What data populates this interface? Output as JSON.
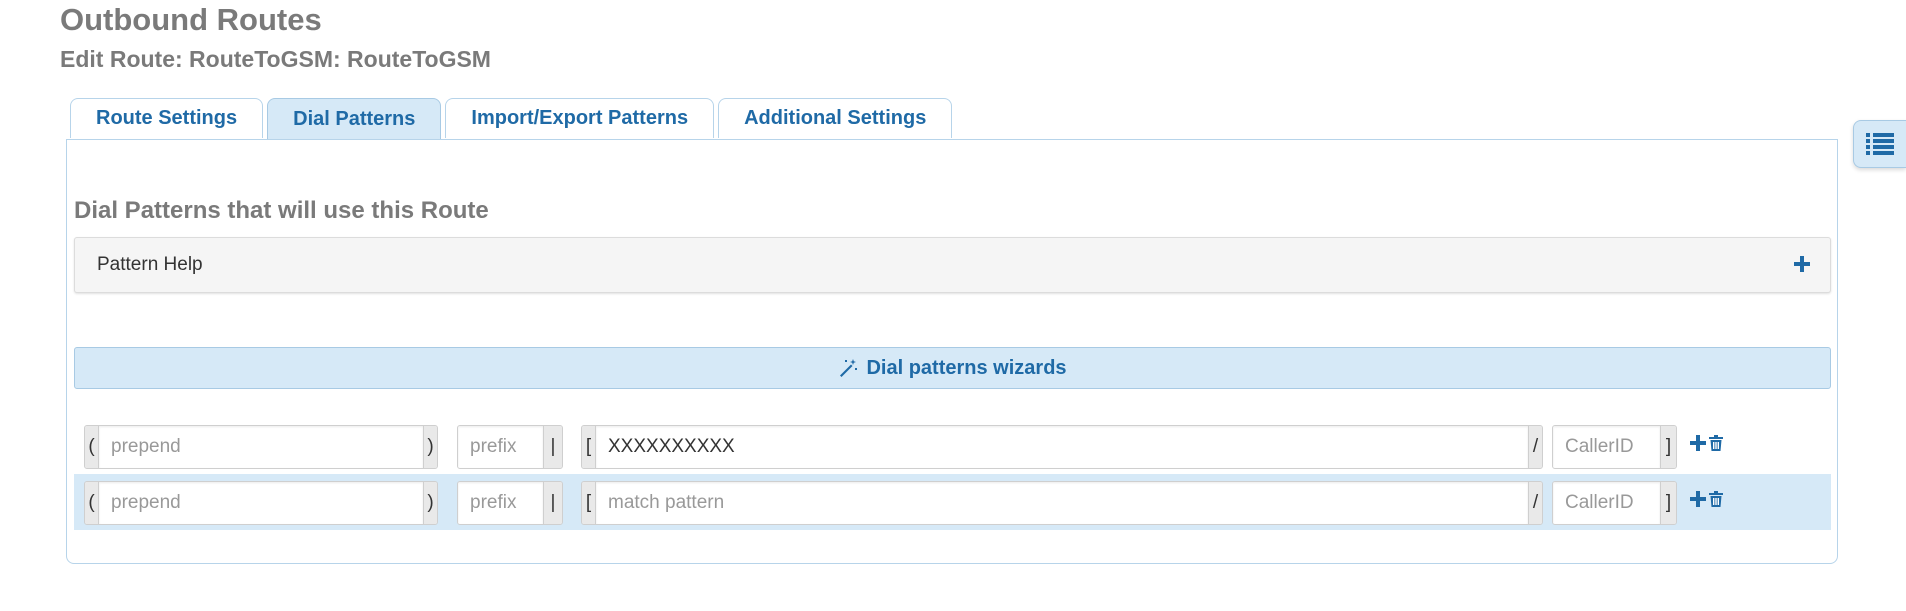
{
  "header": {
    "title": "Outbound Routes",
    "subtitle": "Edit Route: RouteToGSM: RouteToGSM"
  },
  "tabs": [
    {
      "label": "Route Settings",
      "active": false
    },
    {
      "label": "Dial Patterns",
      "active": true
    },
    {
      "label": "Import/Export Patterns",
      "active": false
    },
    {
      "label": "Additional Settings",
      "active": false
    }
  ],
  "section": {
    "heading": "Dial Patterns that will use this Route",
    "help_label": "Pattern Help",
    "wizard_label": "Dial patterns wizards"
  },
  "addons": {
    "prepend_open": "(",
    "prepend_close": ")",
    "prefix_sep": "|",
    "match_open": "[",
    "match_sep": "/",
    "caller_close": "]"
  },
  "placeholders": {
    "prepend": "prepend",
    "prefix": "prefix",
    "match": "match pattern",
    "callerid": "CallerID"
  },
  "rows": [
    {
      "prepend": "",
      "prefix": "",
      "match": "XXXXXXXXXX",
      "callerid": ""
    },
    {
      "prepend": "",
      "prefix": "",
      "match": "",
      "callerid": ""
    }
  ],
  "icons": {
    "side_toggle": "list-icon",
    "help_expand": "plus-icon",
    "wizard": "magic-wand-icon",
    "add": "plus-icon",
    "delete": "trash-icon"
  },
  "colors": {
    "accent": "#1f6aa6",
    "active_tab_bg": "#d6e9f7",
    "heading_gray": "#7a7a7a"
  }
}
